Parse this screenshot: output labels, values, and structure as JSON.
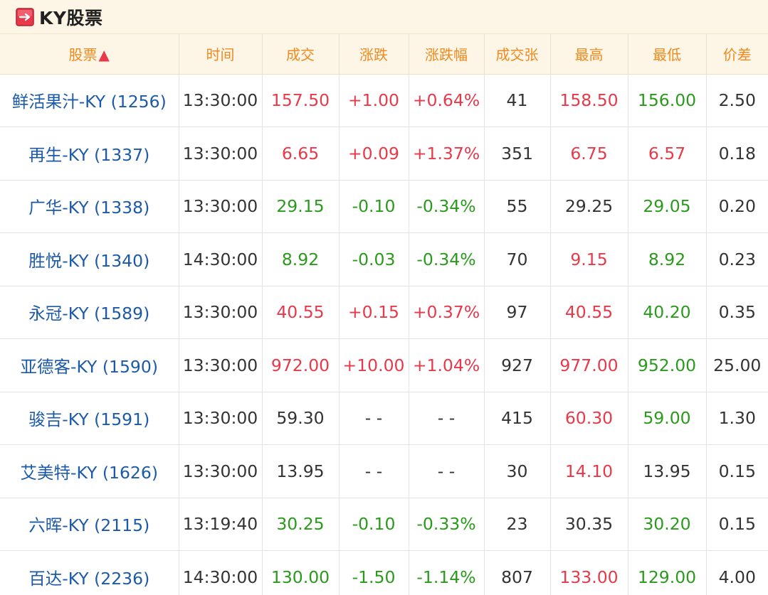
{
  "title": {
    "icon": "red-arrow-box-icon",
    "text": "KY股票"
  },
  "colors": {
    "up": "#e8394a",
    "down": "#2a9a1c",
    "flat": "#333333",
    "link": "#1c5aa8",
    "header_text": "#f08a1f",
    "header_bg": "#fdf6e6"
  },
  "table": {
    "columns": [
      "股票",
      "时间",
      "成交",
      "涨跌",
      "涨跌幅",
      "成交张",
      "最高",
      "最低",
      "价差"
    ],
    "sort_indicator": "▲",
    "rows": [
      {
        "name": "鲜活果汁-KY (1256)",
        "time": "13:30:00",
        "price": "157.50",
        "change": "+1.00",
        "pct": "+0.64%",
        "volume": "41",
        "high": "158.50",
        "low": "156.00",
        "spread": "2.50",
        "price_c": "up",
        "change_c": "up",
        "pct_c": "up",
        "high_c": "up",
        "low_c": "down"
      },
      {
        "name": "再生-KY (1337)",
        "time": "13:30:00",
        "price": "6.65",
        "change": "+0.09",
        "pct": "+1.37%",
        "volume": "351",
        "high": "6.75",
        "low": "6.57",
        "spread": "0.18",
        "price_c": "up",
        "change_c": "up",
        "pct_c": "up",
        "high_c": "up",
        "low_c": "up"
      },
      {
        "name": "广华-KY (1338)",
        "time": "13:30:00",
        "price": "29.15",
        "change": "-0.10",
        "pct": "-0.34%",
        "volume": "55",
        "high": "29.25",
        "low": "29.05",
        "spread": "0.20",
        "price_c": "down",
        "change_c": "down",
        "pct_c": "down",
        "high_c": "flat",
        "low_c": "down"
      },
      {
        "name": "胜悦-KY (1340)",
        "time": "14:30:00",
        "price": "8.92",
        "change": "-0.03",
        "pct": "-0.34%",
        "volume": "70",
        "high": "9.15",
        "low": "8.92",
        "spread": "0.23",
        "price_c": "down",
        "change_c": "down",
        "pct_c": "down",
        "high_c": "up",
        "low_c": "down"
      },
      {
        "name": "永冠-KY (1589)",
        "time": "13:30:00",
        "price": "40.55",
        "change": "+0.15",
        "pct": "+0.37%",
        "volume": "97",
        "high": "40.55",
        "low": "40.20",
        "spread": "0.35",
        "price_c": "up",
        "change_c": "up",
        "pct_c": "up",
        "high_c": "up",
        "low_c": "down"
      },
      {
        "name": "亚德客-KY (1590)",
        "time": "13:30:00",
        "price": "972.00",
        "change": "+10.00",
        "pct": "+1.04%",
        "volume": "927",
        "high": "977.00",
        "low": "952.00",
        "spread": "25.00",
        "price_c": "up",
        "change_c": "up",
        "pct_c": "up",
        "high_c": "up",
        "low_c": "down"
      },
      {
        "name": "骏吉-KY (1591)",
        "time": "13:30:00",
        "price": "59.30",
        "change": "- -",
        "pct": "- -",
        "volume": "415",
        "high": "60.30",
        "low": "59.00",
        "spread": "1.30",
        "price_c": "flat",
        "change_c": "flat",
        "pct_c": "flat",
        "high_c": "up",
        "low_c": "down"
      },
      {
        "name": "艾美特-KY (1626)",
        "time": "13:30:00",
        "price": "13.95",
        "change": "- -",
        "pct": "- -",
        "volume": "30",
        "high": "14.10",
        "low": "13.95",
        "spread": "0.15",
        "price_c": "flat",
        "change_c": "flat",
        "pct_c": "flat",
        "high_c": "up",
        "low_c": "flat"
      },
      {
        "name": "六晖-KY (2115)",
        "time": "13:19:40",
        "price": "30.25",
        "change": "-0.10",
        "pct": "-0.33%",
        "volume": "23",
        "high": "30.35",
        "low": "30.20",
        "spread": "0.15",
        "price_c": "down",
        "change_c": "down",
        "pct_c": "down",
        "high_c": "flat",
        "low_c": "down"
      },
      {
        "name": "百达-KY (2236)",
        "time": "14:30:00",
        "price": "130.00",
        "change": "-1.50",
        "pct": "-1.14%",
        "volume": "807",
        "high": "133.00",
        "low": "129.00",
        "spread": "4.00",
        "price_c": "down",
        "change_c": "down",
        "pct_c": "down",
        "high_c": "up",
        "low_c": "down"
      }
    ]
  }
}
